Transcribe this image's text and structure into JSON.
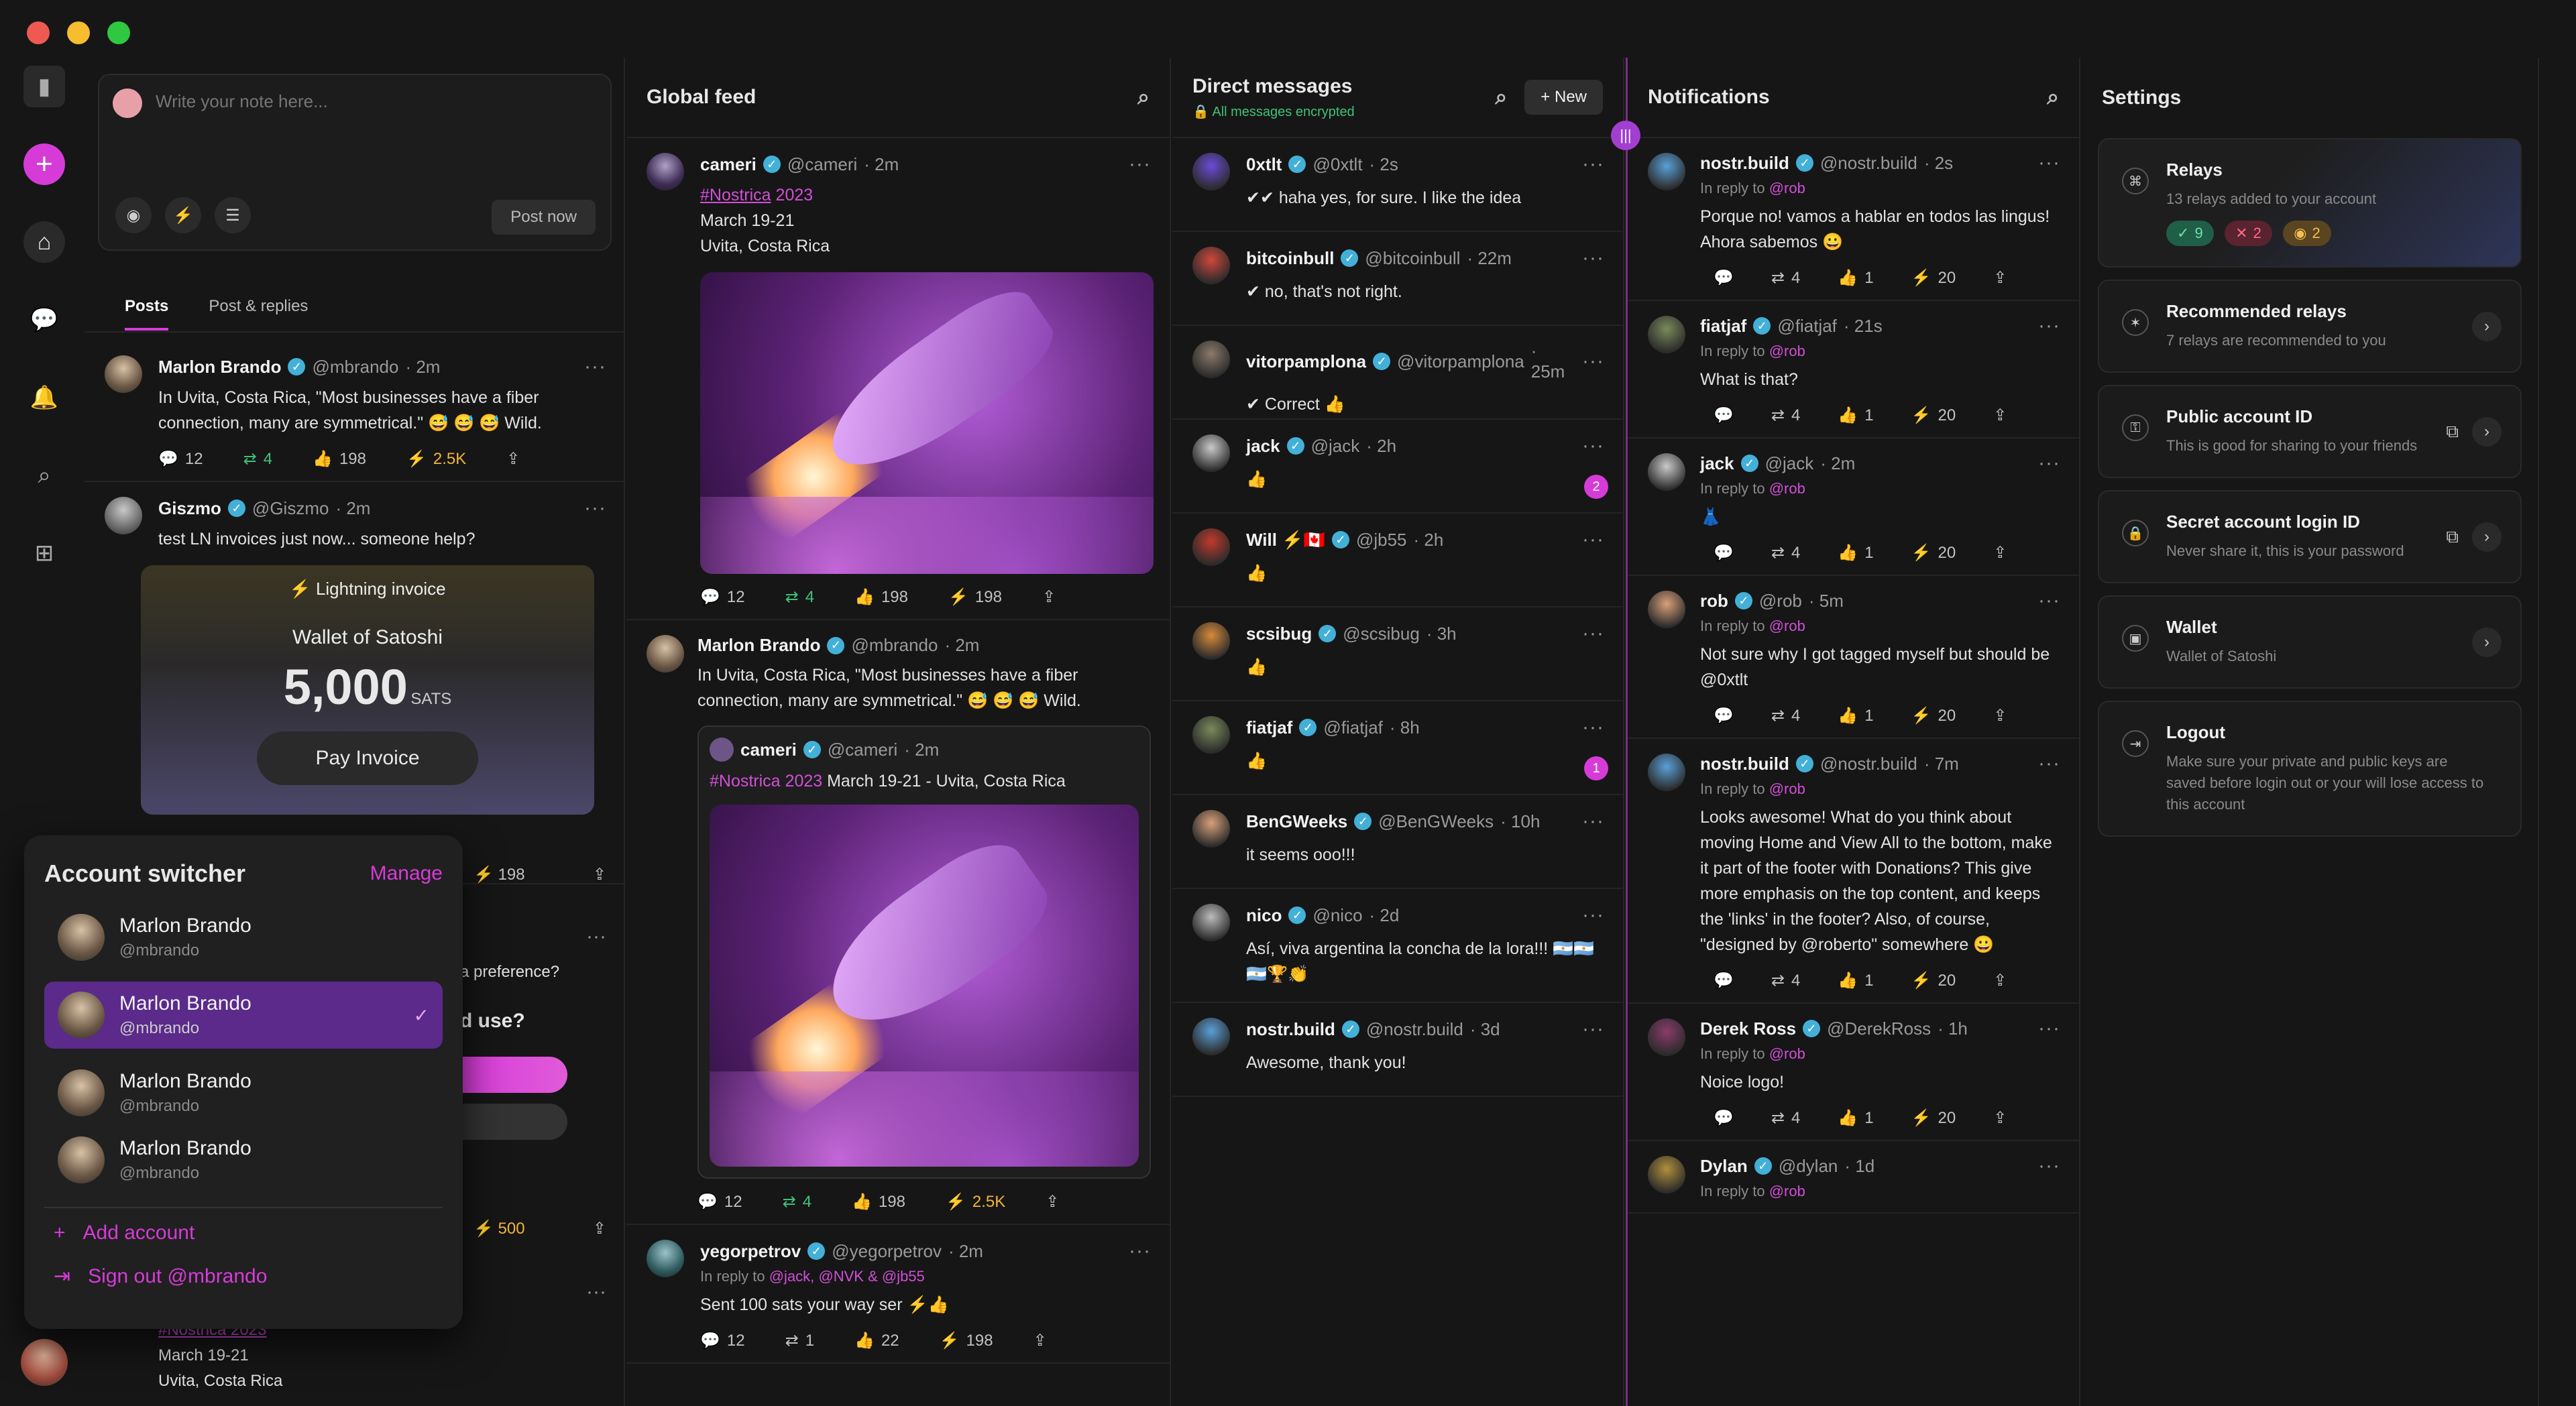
{
  "colors": {
    "accent": "#d63bd8",
    "verified": "#43b0d8",
    "green": "#3fc27a"
  },
  "composer": {
    "placeholder": "Write your note here...",
    "post_label": "Post now"
  },
  "tabs": {
    "posts": "Posts",
    "replies": "Post & replies"
  },
  "feed_posts": [
    {
      "name": "Marlon Brando",
      "handle": "@mbrando",
      "time": "· 2m",
      "text": "In Uvita, Costa Rica, \"Most businesses have a fiber connection, many are symmetrical.\" 😅 😅 😅 Wild.",
      "replies": "12",
      "reposts": "4",
      "likes": "198",
      "zaps": "2.5K"
    },
    {
      "name": "Giszmo",
      "handle": "@Giszmo",
      "time": "· 2m",
      "text": "test LN invoices just now... someone help?"
    }
  ],
  "invoice": {
    "title": "⚡ Lightning invoice",
    "wallet": "Wallet of Satoshi",
    "amount": "5,000",
    "unit": "SATS",
    "pay": "Pay Invoice"
  },
  "partial": {
    "zaps1": "198",
    "preference": "a preference?",
    "question": "d use?",
    "zaps2": "500",
    "hashtag": "#Nostrica 2023",
    "date": "March 19-21",
    "place": "Uvita, Costa Rica"
  },
  "account_switcher": {
    "title": "Account switcher",
    "manage": "Manage",
    "accounts": [
      {
        "name": "Marlon Brando",
        "handle": "@mbrando"
      },
      {
        "name": "Marlon Brando",
        "handle": "@mbrando"
      },
      {
        "name": "Marlon Brando",
        "handle": "@mbrando"
      },
      {
        "name": "Marlon Brando",
        "handle": "@mbrando"
      }
    ],
    "add": "Add account",
    "signout": "Sign out @mbrando"
  },
  "global": {
    "title": "Global feed",
    "p1": {
      "name": "cameri",
      "handle": "@cameri",
      "time": "· 2m",
      "hashtag": "#Nostrica",
      "tag_rest": " 2023",
      "date": "March 19-21",
      "place": "Uvita, Costa Rica",
      "replies": "12",
      "reposts": "4",
      "likes": "198",
      "zaps": "198"
    },
    "p2": {
      "name": "Marlon Brando",
      "handle": "@mbrando",
      "time": "· 2m",
      "text": "In Uvita, Costa Rica, \"Most businesses have a fiber connection, many are symmetrical.\" 😅 😅 😅 Wild.",
      "q_name": "cameri",
      "q_handle": "@cameri",
      "q_time": "· 2m",
      "q_tag": "#Nostrica 2023",
      "q_rest": " March 19-21 - Uvita, Costa Rica",
      "replies": "12",
      "reposts": "4",
      "likes": "198",
      "zaps": "2.5K"
    },
    "p3": {
      "name": "yegorpetrov",
      "handle": "@yegorpetrov",
      "time": "· 2m",
      "reply_prefix": "In reply to ",
      "reply_to": "@jack, @NVK & @jb55",
      "text": "Sent 100 sats your way ser ⚡👍",
      "replies": "12",
      "reposts": "1",
      "likes": "22",
      "zaps": "198"
    }
  },
  "dms": {
    "title": "Direct messages",
    "encrypted": "All messages encrypted",
    "new": "New",
    "items": [
      {
        "name": "0xtlt",
        "handle": "@0xtlt",
        "time": "· 2s",
        "text": "✔✔ haha yes, for sure. I like the idea",
        "badge": ""
      },
      {
        "name": "bitcoinbull",
        "handle": "@bitcoinbull",
        "time": "· 22m",
        "text": "✔ no, that's not right.",
        "badge": ""
      },
      {
        "name": "vitorpamplona",
        "handle": "@vitorpamplona",
        "time": "· 25m",
        "text": "✔ Correct 👍",
        "badge": ""
      },
      {
        "name": "jack",
        "handle": "@jack",
        "time": "· 2h",
        "text": "👍",
        "badge": "2"
      },
      {
        "name": "Will ⚡🇨🇦",
        "handle": "@jb55",
        "time": "· 2h",
        "text": "👍",
        "badge": ""
      },
      {
        "name": "scsibug",
        "handle": "@scsibug",
        "time": "· 3h",
        "text": "👍",
        "badge": ""
      },
      {
        "name": "fiatjaf",
        "handle": "@fiatjaf",
        "time": "· 8h",
        "text": "👍",
        "badge": "1"
      },
      {
        "name": "BenGWeeks",
        "handle": "@BenGWeeks",
        "time": "· 10h",
        "text": "it seems ooo!!!",
        "badge": ""
      },
      {
        "name": "nico",
        "handle": "@nico",
        "time": "· 2d",
        "text": "Así, viva argentina la concha de la lora!!! 🇦🇷🇦🇷🇦🇷🏆👏",
        "badge": ""
      },
      {
        "name": "nostr.build",
        "handle": "@nostr.build",
        "time": "· 3d",
        "text": "Awesome, thank you!",
        "badge": ""
      }
    ]
  },
  "notifications": {
    "title": "Notifications",
    "reply_prefix": "In reply to ",
    "items": [
      {
        "name": "nostr.build",
        "handle": "@nostr.build",
        "time": "· 2s",
        "reply": "@rob",
        "text": "Porque no! vamos a hablar en todos las lingus! Ahora sabemos 😀"
      },
      {
        "name": "fiatjaf",
        "handle": "@fiatjaf",
        "time": "· 21s",
        "reply": "@rob",
        "text": "What is that?"
      },
      {
        "name": "jack",
        "handle": "@jack",
        "time": "· 2m",
        "reply": "@rob",
        "text": "👗"
      },
      {
        "name": "rob",
        "handle": "@rob",
        "time": "· 5m",
        "reply": "@rob",
        "text": "Not sure why I got tagged myself but should be @0xtlt"
      },
      {
        "name": "nostr.build",
        "handle": "@nostr.build",
        "time": "· 7m",
        "reply": "@rob",
        "text": "Looks awesome! What do you think about moving Home and View All to the bottom, make it part of the footer with Donations? This give more emphasis on the top content, and keeps the 'links' in the footer? Also, of course, \"designed by @roberto\" somewhere 😀"
      },
      {
        "name": "Derek Ross",
        "handle": "@DerekRoss",
        "time": "· 1h",
        "reply": "@rob",
        "text": "Noice logo!"
      },
      {
        "name": "Dylan",
        "handle": "@dylan",
        "time": "· 1d",
        "reply": "@rob",
        "text": ""
      }
    ],
    "stats": {
      "reposts": "4",
      "likes": "1",
      "zaps": "20"
    }
  },
  "settings": {
    "title": "Settings",
    "cards": [
      {
        "title": "Relays",
        "desc": "13 relays added to your account",
        "ok": "9",
        "bad": "2",
        "warn": "2"
      },
      {
        "title": "Recommended relays",
        "desc": "7 relays are recommended to you"
      },
      {
        "title": "Public account ID",
        "desc": "This is good for sharing to your friends"
      },
      {
        "title": "Secret account login ID",
        "desc": "Never share it, this is your password"
      },
      {
        "title": "Wallet",
        "desc": "Wallet of Satoshi"
      },
      {
        "title": "Logout",
        "desc": "Make sure your private and public keys are saved before login out or your will lose access to this account"
      }
    ]
  }
}
